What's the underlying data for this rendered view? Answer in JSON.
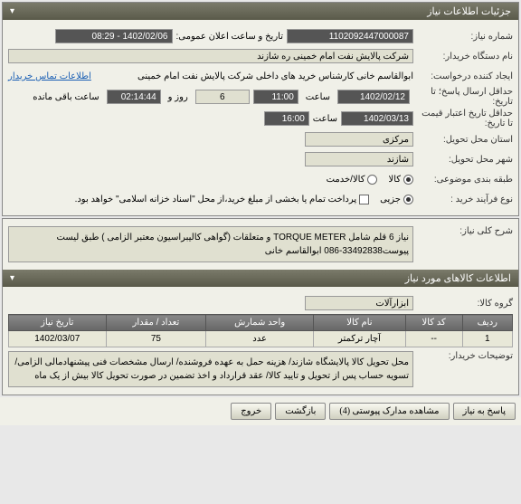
{
  "panel1": {
    "title": "جزئیات اطلاعات نیاز",
    "need_number_label": "شماره نیاز:",
    "need_number": "1102092447000087",
    "announce_label": "تاریخ و ساعت اعلان عمومی:",
    "announce_value": "1402/02/06 - 08:29",
    "buyer_label": "نام دستگاه خریدار:",
    "buyer_value": "شرکت پالایش نفت امام خمینی  ره  شازند",
    "creator_label": "ایجاد کننده درخواست:",
    "creator_value": "ابوالقاسم  خانی  کارشناس خرید های داخلی  شرکت پالایش نفت امام خمینی",
    "contact_link": "اطلاعات تماس خریدار",
    "deadline_label": "حداقل ارسال پاسخ؛  تا تاریخ:",
    "deadline_date": "1402/02/12",
    "time_label": "ساعت",
    "deadline_time": "11:00",
    "days_value": "6",
    "days_label": "روز و",
    "countdown": "02:14:44",
    "remaining": "ساعت باقی مانده",
    "validity_label": "حداقل تاریخ اعتبار قیمت تا تاریخ:",
    "validity_date": "1402/03/13",
    "validity_time": "16:00",
    "province_label": "استان محل تحویل:",
    "province_value": "مرکزی",
    "city_label": "شهر محل تحویل:",
    "city_value": "شازند",
    "category_label": "طبقه بندی موضوعی:",
    "cat_goods": "کالا",
    "cat_service": "کالا/خدمت",
    "process_label": "نوع فرآیند خرید :",
    "proc_partial": "جزیی",
    "proc_check_text": "پرداخت تمام یا بخشی از مبلغ خرید،از محل \"اسناد خزانه اسلامی\" خواهد بود."
  },
  "panel2": {
    "title_label": "شرح کلی نیاز:",
    "title_text": "نیاز 6 قلم شامل TORQUE METER و متعلقات (گواهی کالیبراسیون معتبر الزامی ) طبق لیست پیوست33492838-086 ابوالقاسم خانی",
    "section_title": "اطلاعات کالاهای مورد نیاز",
    "group_label": "گروه کالا:",
    "group_value": "ابزارآلات",
    "th_row": "ردیف",
    "th_code": "کد کالا",
    "th_name": "نام کالا",
    "th_unit": "واحد شمارش",
    "th_qty": "تعداد / مقدار",
    "th_date": "تاریخ نیاز",
    "td_row": "1",
    "td_code": "--",
    "td_name": "آچار ترکمتر",
    "td_unit": "عدد",
    "td_qty": "75",
    "td_date": "1402/03/07",
    "buyer_notes_label": "توضیحات خریدار:",
    "buyer_notes": "محل تحویل کالا پالایشگاه شازند/ هزینه حمل به عهده فروشنده/ ارسال مشخصات فنی  پیشنهادمالی الزامی/ تسویه حساب پس از تحویل و تایید کالا/ عقد قرارداد و اخذ تضمین در صورت تحویل کالا بیش از یک ماه"
  },
  "buttons": {
    "respond": "پاسخ به نیاز",
    "attachments": "مشاهده مدارک پیوستی (4)",
    "back": "بازگشت",
    "exit": "خروج"
  }
}
